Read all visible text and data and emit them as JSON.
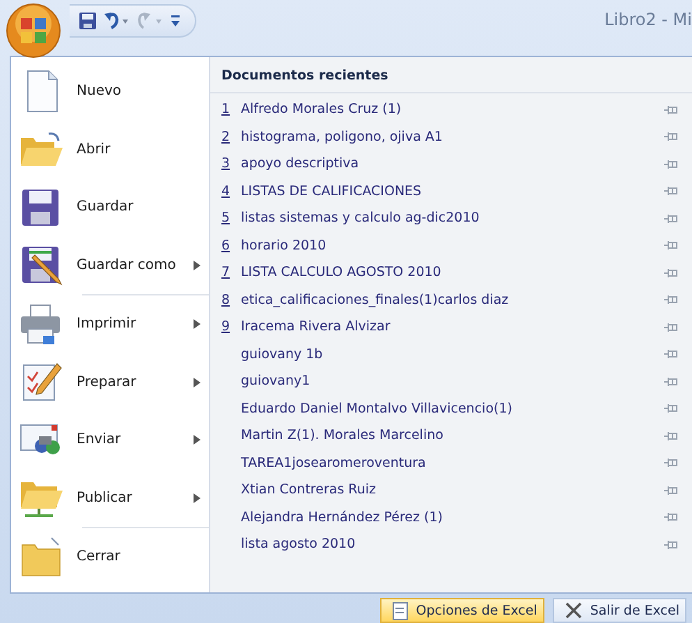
{
  "window": {
    "title": "Libro2 - Mi"
  },
  "quick_access": [
    {
      "kind": "save",
      "disabled": false
    },
    {
      "kind": "undo",
      "disabled": false
    },
    {
      "kind": "redo",
      "disabled": true
    },
    {
      "kind": "customize",
      "disabled": false
    }
  ],
  "menu": {
    "items": [
      {
        "kind": "new",
        "label": "Nuevo",
        "has_submenu": false,
        "divider_after": false
      },
      {
        "kind": "open",
        "label": "Abrir",
        "has_submenu": false,
        "divider_after": false
      },
      {
        "kind": "save",
        "label": "Guardar",
        "has_submenu": false,
        "divider_after": false
      },
      {
        "kind": "save_as",
        "label": "Guardar como",
        "has_submenu": true,
        "divider_after": true
      },
      {
        "kind": "print",
        "label": "Imprimir",
        "has_submenu": true,
        "divider_after": false
      },
      {
        "kind": "prepare",
        "label": "Preparar",
        "has_submenu": true,
        "divider_after": false
      },
      {
        "kind": "send",
        "label": "Enviar",
        "has_submenu": true,
        "divider_after": false
      },
      {
        "kind": "publish",
        "label": "Publicar",
        "has_submenu": true,
        "divider_after": true
      },
      {
        "kind": "close",
        "label": "Cerrar",
        "has_submenu": false,
        "divider_after": false
      }
    ],
    "recent": {
      "heading": "Documentos recientes",
      "items": [
        {
          "number": "1",
          "name": "Alfredo Morales Cruz (1)"
        },
        {
          "number": "2",
          "name": "histograma, poligono, ojiva A1"
        },
        {
          "number": "3",
          "name": "apoyo descriptiva"
        },
        {
          "number": "4",
          "name": "LISTAS DE CALIFICACIONES"
        },
        {
          "number": "5",
          "name": "listas sistemas y calculo ag-dic2010"
        },
        {
          "number": "6",
          "name": "horario 2010"
        },
        {
          "number": "7",
          "name": "LISTA CALCULO AGOSTO 2010"
        },
        {
          "number": "8",
          "name": "etica_calificaciones_finales(1)carlos diaz"
        },
        {
          "number": "9",
          "name": "Iracema Rivera Alvizar"
        },
        {
          "name": "guiovany 1b"
        },
        {
          "name": "guiovany1"
        },
        {
          "name": "Eduardo Daniel Montalvo Villavicencio(1)"
        },
        {
          "name": "Martin Z(1). Morales Marcelino"
        },
        {
          "name": "TAREA1josearomeroventura"
        },
        {
          "name": "Xtian Contreras Ruiz"
        },
        {
          "name": "Alejandra Hernández Pérez (1)"
        },
        {
          "name": "lista agosto 2010"
        }
      ]
    }
  },
  "footer_buttons": [
    {
      "kind": "options",
      "label": "Opciones de Excel",
      "highlighted": true
    },
    {
      "kind": "exit",
      "label": "Salir de Excel",
      "highlighted": false
    }
  ]
}
